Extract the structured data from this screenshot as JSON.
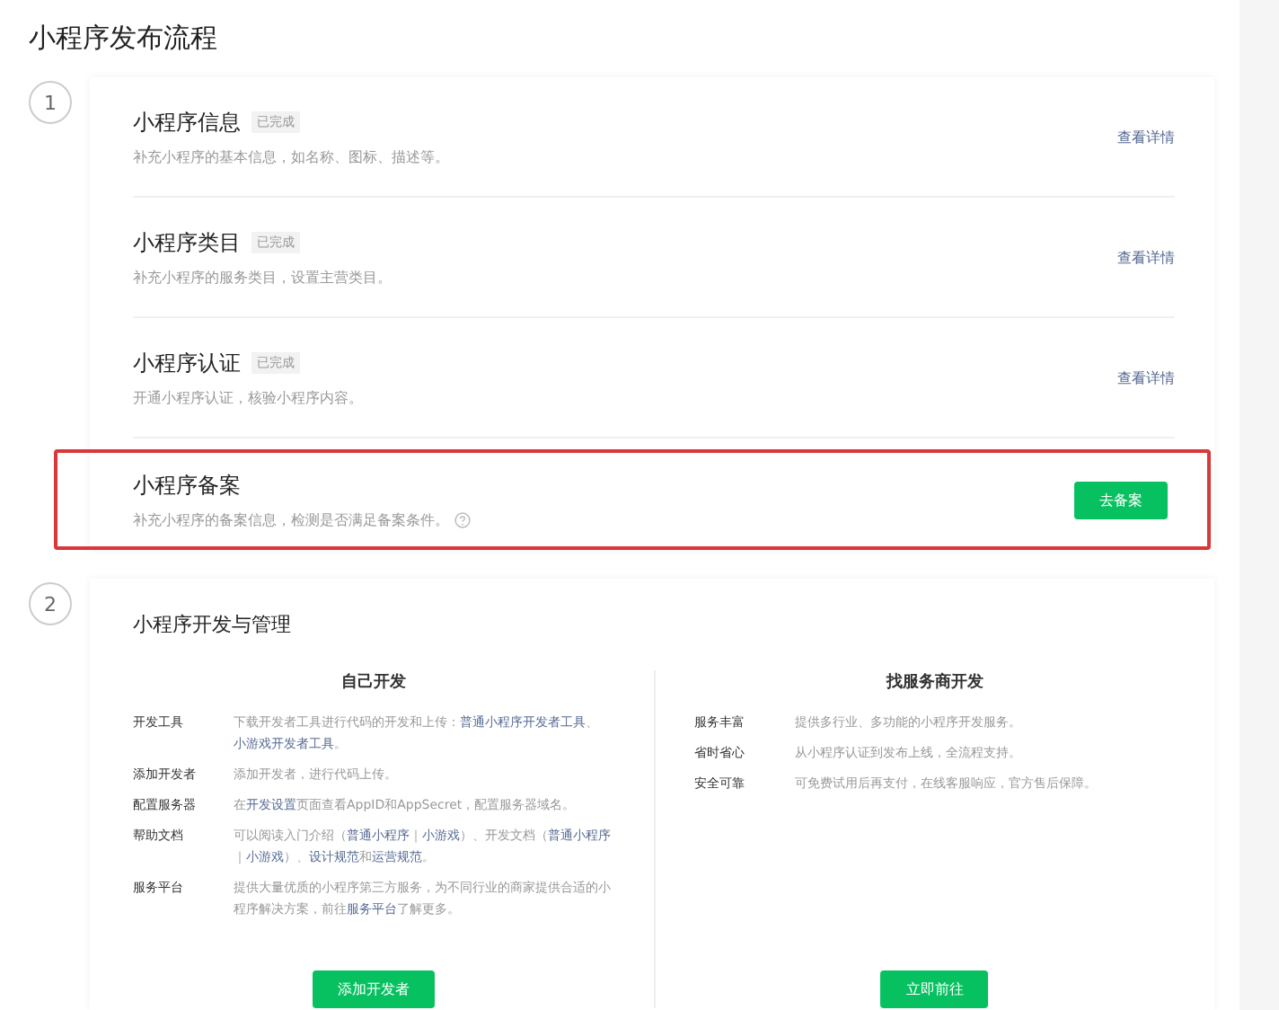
{
  "page_title": "小程序发布流程",
  "steps": [
    {
      "number": "1",
      "kind": "tasks",
      "items": [
        {
          "title": "小程序信息",
          "badge": "已完成",
          "description": "补充小程序的基本信息，如名称、图标、描述等。",
          "help": false,
          "action": {
            "label": "查看详情",
            "kind": "link"
          },
          "highlighted": false
        },
        {
          "title": "小程序类目",
          "badge": "已完成",
          "description": "补充小程序的服务类目，设置主营类目。",
          "help": false,
          "action": {
            "label": "查看详情",
            "kind": "link"
          },
          "highlighted": false
        },
        {
          "title": "小程序认证",
          "badge": "已完成",
          "description": "开通小程序认证，核验小程序内容。",
          "help": false,
          "action": {
            "label": "查看详情",
            "kind": "link"
          },
          "highlighted": false
        },
        {
          "title": "小程序备案",
          "description": "补充小程序的备案信息，检测是否满足备案条件。",
          "help": true,
          "action": {
            "label": "去备案",
            "kind": "button"
          },
          "highlighted": true
        }
      ]
    },
    {
      "number": "2",
      "kind": "development",
      "title": "小程序开发与管理",
      "columns": [
        {
          "heading": "自己开发",
          "rows": [
            {
              "label": "开发工具",
              "parts": [
                {
                  "text": "下载开发者工具进行代码的开发和上传：",
                  "link": false
                },
                {
                  "text": "普通小程序开发者工具",
                  "link": true
                },
                {
                  "text": "、",
                  "link": false
                },
                {
                  "text": "小游戏开发者工具",
                  "link": true
                },
                {
                  "text": "。",
                  "link": false
                }
              ]
            },
            {
              "label": "添加开发者",
              "parts": [
                {
                  "text": "添加开发者，进行代码上传。",
                  "link": false
                }
              ]
            },
            {
              "label": "配置服务器",
              "parts": [
                {
                  "text": "在",
                  "link": false
                },
                {
                  "text": "开发设置",
                  "link": true
                },
                {
                  "text": "页面查看AppID和AppSecret，配置服务器域名。",
                  "link": false
                }
              ]
            },
            {
              "label": "帮助文档",
              "parts": [
                {
                  "text": "可以阅读入门介绍（",
                  "link": false
                },
                {
                  "text": "普通小程序",
                  "link": true
                },
                {
                  "text": "｜",
                  "link": false
                },
                {
                  "text": "小游戏",
                  "link": true
                },
                {
                  "text": "）、开发文档（",
                  "link": false
                },
                {
                  "text": "普通小程序",
                  "link": true
                },
                {
                  "text": "｜",
                  "link": false
                },
                {
                  "text": "小游戏",
                  "link": true
                },
                {
                  "text": "）、",
                  "link": false
                },
                {
                  "text": "设计规范",
                  "link": true
                },
                {
                  "text": "和",
                  "link": false
                },
                {
                  "text": "运营规范",
                  "link": true
                },
                {
                  "text": "。",
                  "link": false
                }
              ]
            },
            {
              "label": "服务平台",
              "parts": [
                {
                  "text": "提供大量优质的小程序第三方服务，为不同行业的商家提供合适的小程序解决方案，前往",
                  "link": false
                },
                {
                  "text": "服务平台",
                  "link": true
                },
                {
                  "text": "了解更多。",
                  "link": false
                }
              ]
            }
          ],
          "button": "添加开发者"
        },
        {
          "heading": "找服务商开发",
          "rows": [
            {
              "label": "服务丰富",
              "parts": [
                {
                  "text": "提供多行业、多功能的小程序开发服务。",
                  "link": false
                }
              ]
            },
            {
              "label": "省时省心",
              "parts": [
                {
                  "text": "从小程序认证到发布上线，全流程支持。",
                  "link": false
                }
              ]
            },
            {
              "label": "安全可靠",
              "parts": [
                {
                  "text": "可免费试用后再支付，在线客服响应，官方售后保障。",
                  "link": false
                }
              ]
            }
          ],
          "button": "立即前往"
        }
      ]
    }
  ]
}
